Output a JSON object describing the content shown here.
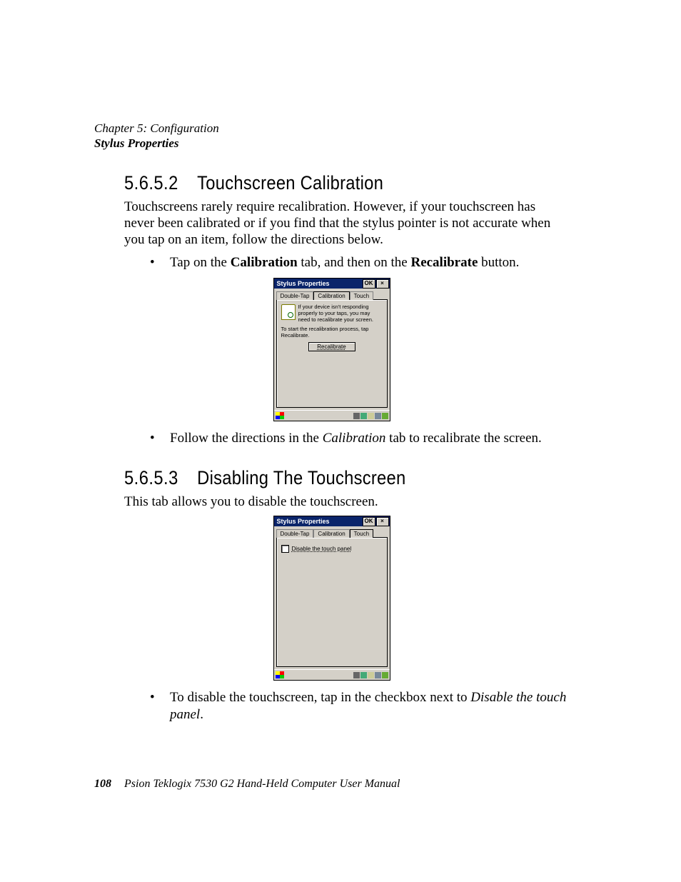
{
  "header": {
    "chapter": "Chapter 5: Configuration",
    "section": "Stylus Properties"
  },
  "section_1": {
    "number": "5.6.5.2",
    "title": "Touchscreen Calibration",
    "intro": "Touchscreens rarely require recalibration. However, if your touchscreen has never been calibrated or if you find that the stylus pointer is not accurate when you tap on an item, follow the directions below.",
    "bullet1_pre": "Tap on the ",
    "bullet1_b1": "Calibration",
    "bullet1_mid": " tab, and then on the ",
    "bullet1_b2": "Recalibrate",
    "bullet1_post": " button.",
    "bullet2_pre": "Follow the directions in the ",
    "bullet2_i": "Calibration",
    "bullet2_post": " tab to recalibrate the screen."
  },
  "dialog1": {
    "title": "Stylus Properties",
    "ok": "OK",
    "close": "×",
    "tabs": {
      "t1": "Double-Tap",
      "t2": "Calibration",
      "t3": "Touch"
    },
    "help": "If your device isn't responding properly to your taps, you may need to recalibrate your screen.",
    "text": "To start the recalibration process, tap Recalibrate.",
    "button": "Recalibrate"
  },
  "section_2": {
    "number": "5.6.5.3",
    "title": "Disabling The Touchscreen",
    "intro": "This tab allows you to disable the touchscreen.",
    "bullet1_pre": "To disable the touchscreen, tap in the checkbox next to ",
    "bullet1_i": "Disable the touch panel",
    "bullet1_post": "."
  },
  "dialog2": {
    "title": "Stylus Properties",
    "ok": "OK",
    "close": "×",
    "tabs": {
      "t1": "Double-Tap",
      "t2": "Calibration",
      "t3": "Touch"
    },
    "checkbox_label": "Disable the touch panel"
  },
  "footer": {
    "page": "108",
    "book": "Psion Teklogix 7530 G2 Hand-Held Computer User Manual"
  }
}
